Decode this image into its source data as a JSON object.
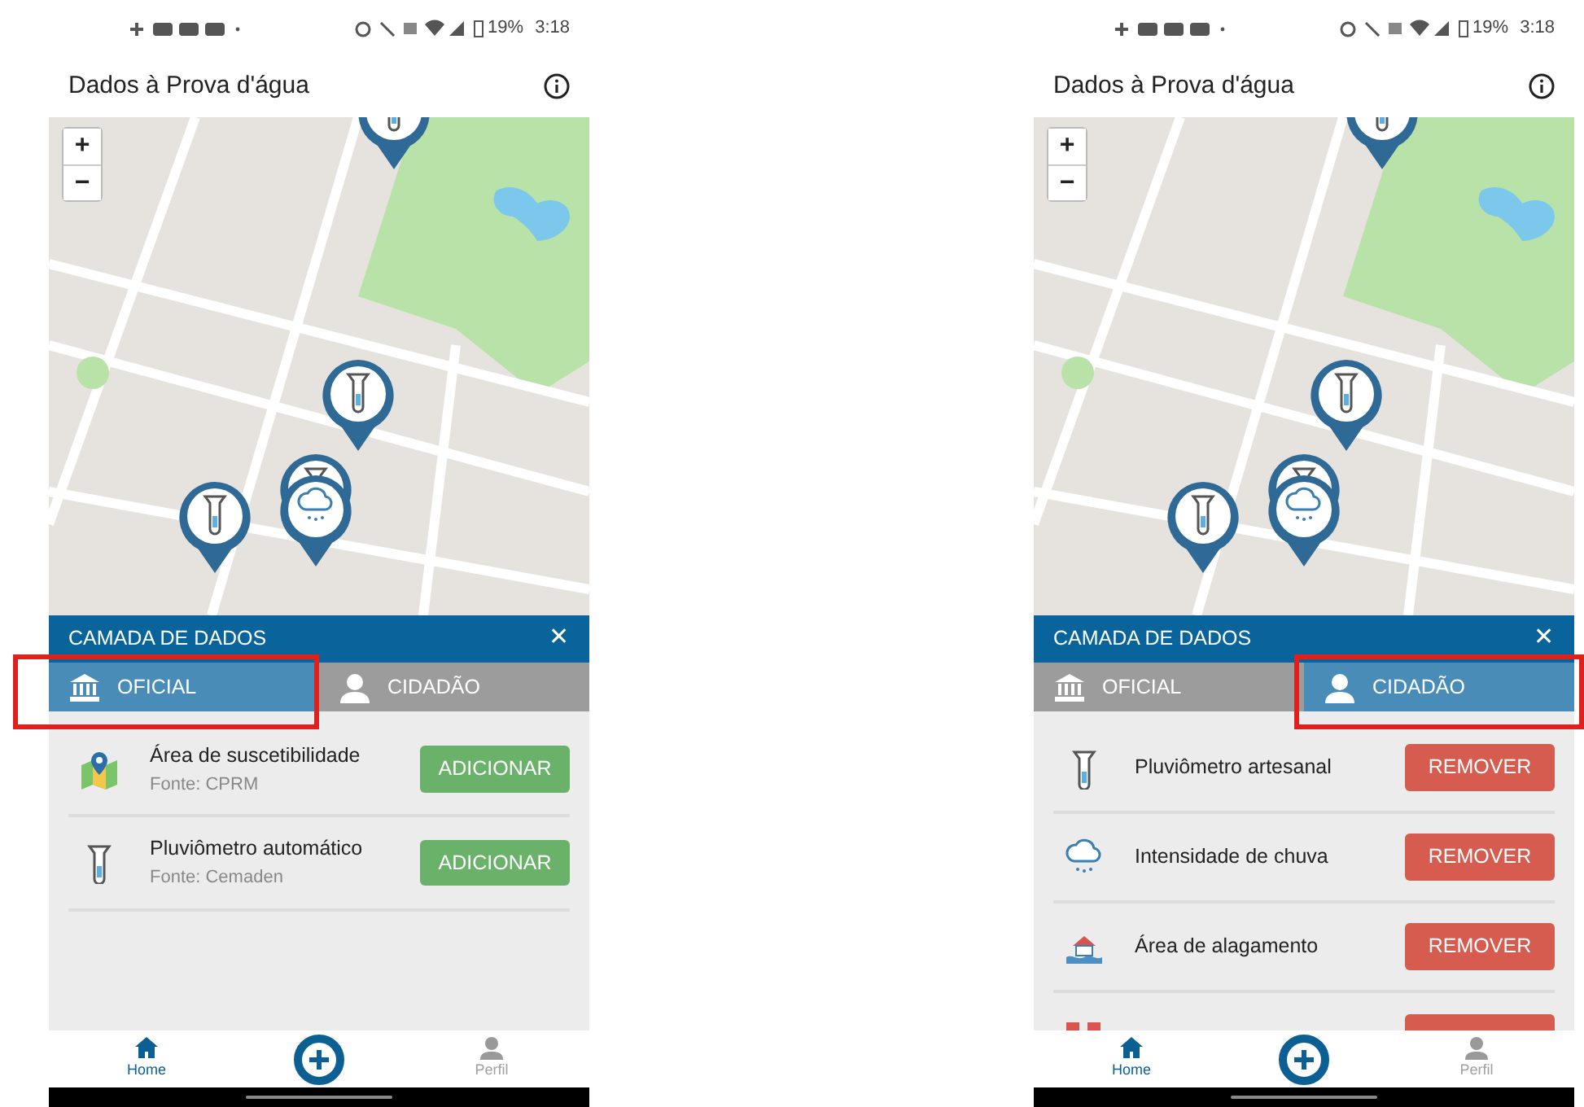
{
  "screens": [
    {
      "status_bar": {
        "battery": "19%",
        "time": "3:18"
      },
      "title": "Dados à Prova d'água",
      "map": {
        "zoom_in": "+",
        "zoom_out": "−",
        "markers": [
          {
            "kind": "gauge"
          },
          {
            "kind": "gauge"
          },
          {
            "kind": "gauge"
          },
          {
            "kind": "rain"
          },
          {
            "kind": "gauge"
          }
        ]
      },
      "panel": {
        "title": "CAMADA DE DADOS",
        "close": "✕",
        "tabs": [
          {
            "label": "OFICIAL",
            "selected": true,
            "highlighted": true
          },
          {
            "label": "CIDADÃO",
            "selected": false,
            "highlighted": false
          }
        ],
        "layers": [
          {
            "kind": "map",
            "name": "Área de suscetibilidade",
            "source": "Fonte: CPRM",
            "button": {
              "label": "ADICIONAR",
              "kind": "add"
            }
          },
          {
            "kind": "gauge",
            "name": "Pluviômetro automático",
            "source": "Fonte: Cemaden",
            "button": {
              "label": "ADICIONAR",
              "kind": "add"
            }
          }
        ]
      },
      "nav": [
        {
          "kind": "home",
          "label": "Home",
          "selected": true
        },
        {
          "kind": "add"
        },
        {
          "kind": "profile",
          "label": "Perfil",
          "selected": false
        }
      ]
    },
    {
      "status_bar": {
        "battery": "19%",
        "time": "3:18"
      },
      "title": "Dados à Prova d'água",
      "map": {
        "zoom_in": "+",
        "zoom_out": "−",
        "markers": [
          {
            "kind": "gauge"
          },
          {
            "kind": "gauge"
          },
          {
            "kind": "gauge"
          },
          {
            "kind": "rain"
          },
          {
            "kind": "gauge"
          }
        ]
      },
      "panel": {
        "title": "CAMADA DE DADOS",
        "close": "✕",
        "tabs": [
          {
            "label": "OFICIAL",
            "selected": false,
            "highlighted": false
          },
          {
            "label": "CIDADÃO",
            "selected": true,
            "highlighted": true
          }
        ],
        "layers": [
          {
            "kind": "gauge",
            "name": "Pluviômetro artesanal",
            "button": {
              "label": "REMOVER",
              "kind": "remove"
            }
          },
          {
            "kind": "rain",
            "name": "Intensidade de chuva",
            "button": {
              "label": "REMOVER",
              "kind": "remove"
            }
          },
          {
            "kind": "flood",
            "name": "Área de alagamento",
            "button": {
              "label": "REMOVER",
              "kind": "remove"
            }
          },
          {
            "kind": "risk",
            "button": {
              "kind": "remove"
            }
          }
        ]
      },
      "nav": [
        {
          "kind": "home",
          "label": "Home",
          "selected": true
        },
        {
          "kind": "add"
        },
        {
          "kind": "profile",
          "label": "Perfil",
          "selected": false
        }
      ]
    }
  ]
}
